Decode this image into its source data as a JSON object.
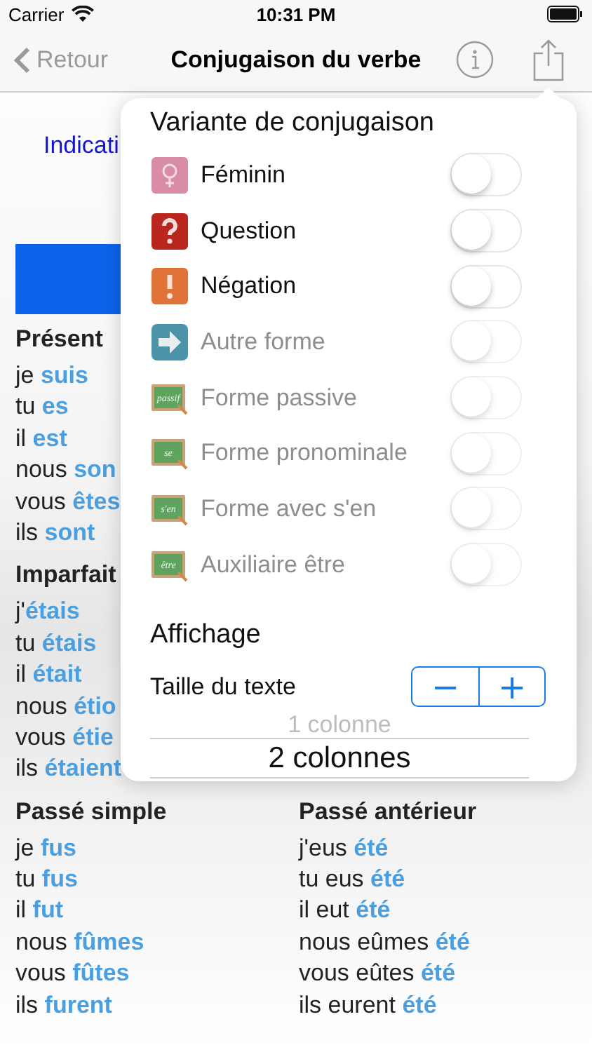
{
  "status_bar": {
    "carrier": "Carrier",
    "time": "10:31 PM"
  },
  "nav_bar": {
    "back": "Retour",
    "title": "Conjugaison du verbe"
  },
  "mode_tab": "Indicati",
  "tense_rows": [
    {
      "left": {
        "title": "Présent",
        "lines": [
          {
            "pronoun": "je ",
            "verb": "suis"
          },
          {
            "pronoun": "tu ",
            "verb": "es"
          },
          {
            "pronoun": "il ",
            "verb": "est"
          },
          {
            "pronoun": "nous ",
            "verb": "son"
          },
          {
            "pronoun": "vous ",
            "verb": "êtes"
          },
          {
            "pronoun": "ils ",
            "verb": "sont"
          }
        ]
      }
    },
    {
      "left": {
        "title": "Imparfait",
        "lines": [
          {
            "pronoun": "j'",
            "verb": "étais"
          },
          {
            "pronoun": "tu ",
            "verb": "étais"
          },
          {
            "pronoun": "il ",
            "verb": "était"
          },
          {
            "pronoun": "nous ",
            "verb": "étio"
          },
          {
            "pronoun": "vous ",
            "verb": "étie"
          },
          {
            "pronoun": "ils ",
            "verb": "étaient"
          }
        ]
      }
    },
    {
      "left": {
        "title": "Passé simple",
        "lines": [
          {
            "pronoun": "je ",
            "verb": "fus"
          },
          {
            "pronoun": "tu ",
            "verb": "fus"
          },
          {
            "pronoun": "il ",
            "verb": "fut"
          },
          {
            "pronoun": "nous ",
            "verb": "fûmes"
          },
          {
            "pronoun": "vous ",
            "verb": "fûtes"
          },
          {
            "pronoun": "ils ",
            "verb": "furent"
          }
        ]
      },
      "right": {
        "title": "Passé antérieur",
        "lines": [
          {
            "pronoun": "j'eus ",
            "verb": "été"
          },
          {
            "pronoun": "tu eus ",
            "verb": "été"
          },
          {
            "pronoun": "il eut ",
            "verb": "été"
          },
          {
            "pronoun": "nous eûmes ",
            "verb": "été"
          },
          {
            "pronoun": "vous eûtes ",
            "verb": "été"
          },
          {
            "pronoun": "ils eurent ",
            "verb": "été"
          }
        ]
      }
    }
  ],
  "popover": {
    "title": "Variante de conjugaison",
    "variants": [
      {
        "kind": "feminine",
        "label": "Féminin",
        "on": false,
        "disabled": false
      },
      {
        "kind": "question",
        "label": "Question",
        "on": false,
        "disabled": false
      },
      {
        "kind": "negation",
        "label": "Négation",
        "on": false,
        "disabled": false
      },
      {
        "kind": "arrow",
        "label": "Autre forme",
        "on": false,
        "disabled": true
      },
      {
        "kind": "board",
        "board_text": "passif",
        "label": "Forme passive",
        "on": false,
        "disabled": true
      },
      {
        "kind": "board",
        "board_text": "se",
        "label": "Forme pronominale",
        "on": false,
        "disabled": true
      },
      {
        "kind": "board",
        "board_text": "s'en",
        "label": "Forme avec s'en",
        "on": false,
        "disabled": true
      },
      {
        "kind": "board",
        "board_text": "être",
        "label": "Auxiliaire être",
        "on": false,
        "disabled": true
      }
    ],
    "display_title": "Affichage",
    "text_size": {
      "label": "Taille du texte",
      "decrease": "−",
      "increase": "+"
    },
    "columns_picker": [
      {
        "label": "1 colonne",
        "selected": false
      },
      {
        "label": "2 colonnes",
        "selected": true
      }
    ]
  }
}
